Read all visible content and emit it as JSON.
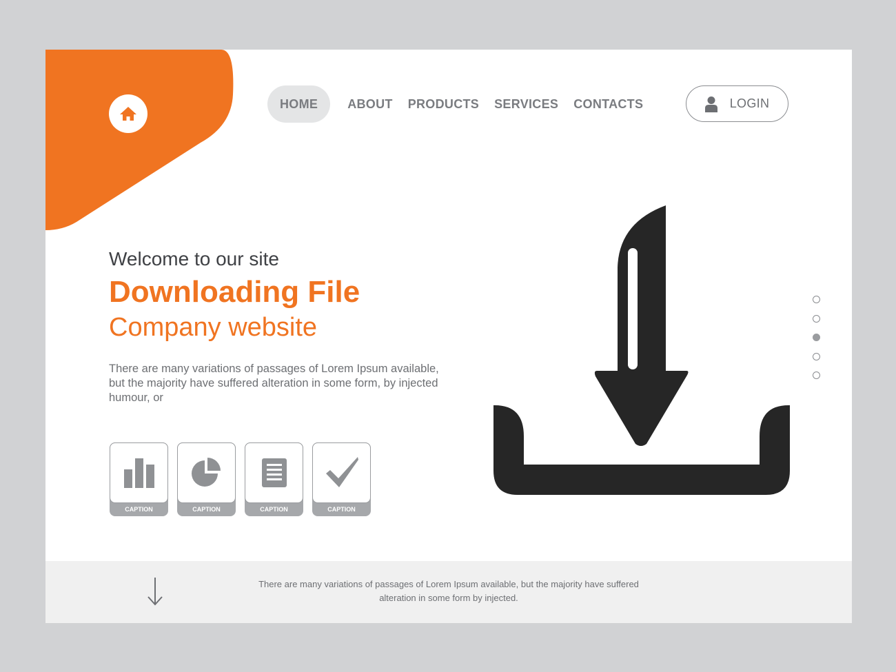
{
  "nav": {
    "items": [
      {
        "label": "HOME",
        "active": true
      },
      {
        "label": "ABOUT",
        "active": false
      },
      {
        "label": "PRODUCTS",
        "active": false
      },
      {
        "label": "SERVICES",
        "active": false
      },
      {
        "label": "CONTACTS",
        "active": false
      }
    ],
    "login_label": "LOGIN"
  },
  "hero": {
    "welcome": "Welcome to our site",
    "title": "Downloading File",
    "subtitle": "Company website",
    "body": "There are many variations of passages of Lorem Ipsum available, but the majority have suffered alteration in some form, by injected humour, or"
  },
  "cards": [
    {
      "icon": "bar-chart-icon",
      "caption": "CAPTION"
    },
    {
      "icon": "pie-chart-icon",
      "caption": "CAPTION"
    },
    {
      "icon": "document-icon",
      "caption": "CAPTION"
    },
    {
      "icon": "checkmark-icon",
      "caption": "CAPTION"
    }
  ],
  "main_icon": "download-icon",
  "pager": {
    "count": 5,
    "active_index": 2
  },
  "footer": {
    "text": "There are many variations of passages of Lorem Ipsum available, but the majority have suffered alteration in some form by injected."
  },
  "colors": {
    "accent": "#f07421",
    "background": "#d1d2d4",
    "page": "#ffffff",
    "text": "#3f4145",
    "muted": "#7a7c80",
    "icon_dark": "#262626"
  }
}
